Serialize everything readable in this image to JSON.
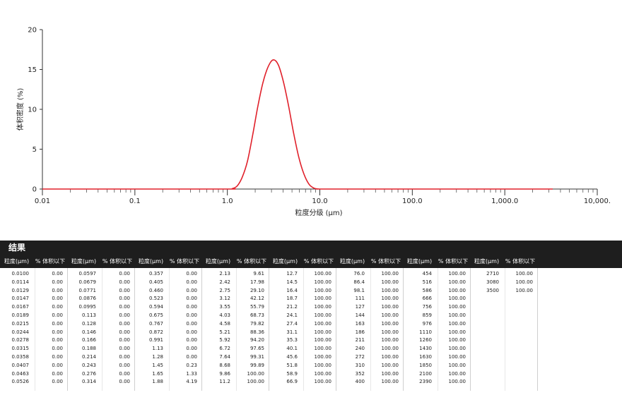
{
  "chart_data": {
    "type": "line",
    "title": "",
    "xlabel": "粒度分级 (μm)",
    "ylabel": "体积密度 (%)",
    "x_scale": "log",
    "xlim": [
      0.01,
      10000
    ],
    "ylim": [
      0,
      20
    ],
    "x_ticks": [
      "0.01",
      "0.1",
      "1.0",
      "10.0",
      "100.0",
      "1,000.0",
      "10,000."
    ],
    "y_ticks": [
      "0",
      "5",
      "10",
      "15",
      "20"
    ],
    "grid": false,
    "line_color": "#e0202a",
    "series": [
      {
        "x": [
          0.01,
          0.1,
          1.0,
          1.13,
          1.28,
          1.45,
          1.65,
          1.88,
          2.13,
          2.42,
          2.75,
          3.12,
          3.55,
          4.03,
          4.58,
          5.21,
          5.92,
          6.72,
          7.64,
          8.68,
          9.86,
          11.2,
          100,
          1000,
          3300
        ],
        "y": [
          0,
          0,
          0,
          0.05,
          0.4,
          1.5,
          3.5,
          6.8,
          10.3,
          13.3,
          15.3,
          16.2,
          15.6,
          13.5,
          10.5,
          7.0,
          4.0,
          1.9,
          0.6,
          0.1,
          0,
          0,
          0,
          0,
          0
        ]
      }
    ]
  },
  "results": {
    "title": "结果",
    "col_size_label": "粒度(μm)",
    "col_pct_label": "% 体积以下",
    "groups": [
      {
        "size": [
          "0.0100",
          "0.0114",
          "0.0129",
          "0.0147",
          "0.0167",
          "0.0189",
          "0.0215",
          "0.0244",
          "0.0278",
          "0.0315",
          "0.0358",
          "0.0407",
          "0.0463",
          "0.0526"
        ],
        "pct": [
          "0.00",
          "0.00",
          "0.00",
          "0.00",
          "0.00",
          "0.00",
          "0.00",
          "0.00",
          "0.00",
          "0.00",
          "0.00",
          "0.00",
          "0.00",
          "0.00"
        ]
      },
      {
        "size": [
          "0.0597",
          "0.0679",
          "0.0771",
          "0.0876",
          "0.0995",
          "0.113",
          "0.128",
          "0.146",
          "0.166",
          "0.188",
          "0.214",
          "0.243",
          "0.276",
          "0.314"
        ],
        "pct": [
          "0.00",
          "0.00",
          "0.00",
          "0.00",
          "0.00",
          "0.00",
          "0.00",
          "0.00",
          "0.00",
          "0.00",
          "0.00",
          "0.00",
          "0.00",
          "0.00"
        ]
      },
      {
        "size": [
          "0.357",
          "0.405",
          "0.460",
          "0.523",
          "0.594",
          "0.675",
          "0.767",
          "0.872",
          "0.991",
          "1.13",
          "1.28",
          "1.45",
          "1.65",
          "1.88"
        ],
        "pct": [
          "0.00",
          "0.00",
          "0.00",
          "0.00",
          "0.00",
          "0.00",
          "0.00",
          "0.00",
          "0.00",
          "0.00",
          "0.00",
          "0.23",
          "1.33",
          "4.19"
        ]
      },
      {
        "size": [
          "2.13",
          "2.42",
          "2.75",
          "3.12",
          "3.55",
          "4.03",
          "4.58",
          "5.21",
          "5.92",
          "6.72",
          "7.64",
          "8.68",
          "9.86",
          "11.2"
        ],
        "pct": [
          "9.61",
          "17.98",
          "29.10",
          "42.12",
          "55.79",
          "68.73",
          "79.82",
          "88.36",
          "94.20",
          "97.65",
          "99.31",
          "99.89",
          "100.00",
          "100.00"
        ]
      },
      {
        "size": [
          "12.7",
          "14.5",
          "16.4",
          "18.7",
          "21.2",
          "24.1",
          "27.4",
          "31.1",
          "35.3",
          "40.1",
          "45.6",
          "51.8",
          "58.9",
          "66.9"
        ],
        "pct": [
          "100.00",
          "100.00",
          "100.00",
          "100.00",
          "100.00",
          "100.00",
          "100.00",
          "100.00",
          "100.00",
          "100.00",
          "100.00",
          "100.00",
          "100.00",
          "100.00"
        ]
      },
      {
        "size": [
          "76.0",
          "86.4",
          "98.1",
          "111",
          "127",
          "144",
          "163",
          "186",
          "211",
          "240",
          "272",
          "310",
          "352",
          "400"
        ],
        "pct": [
          "100.00",
          "100.00",
          "100.00",
          "100.00",
          "100.00",
          "100.00",
          "100.00",
          "100.00",
          "100.00",
          "100.00",
          "100.00",
          "100.00",
          "100.00",
          "100.00"
        ]
      },
      {
        "size": [
          "454",
          "516",
          "586",
          "666",
          "756",
          "859",
          "976",
          "1110",
          "1260",
          "1430",
          "1630",
          "1850",
          "2100",
          "2390"
        ],
        "pct": [
          "100.00",
          "100.00",
          "100.00",
          "100.00",
          "100.00",
          "100.00",
          "100.00",
          "100.00",
          "100.00",
          "100.00",
          "100.00",
          "100.00",
          "100.00",
          "100.00"
        ]
      },
      {
        "size": [
          "2710",
          "3080",
          "3500"
        ],
        "pct": [
          "100.00",
          "100.00",
          "100.00"
        ]
      }
    ]
  }
}
